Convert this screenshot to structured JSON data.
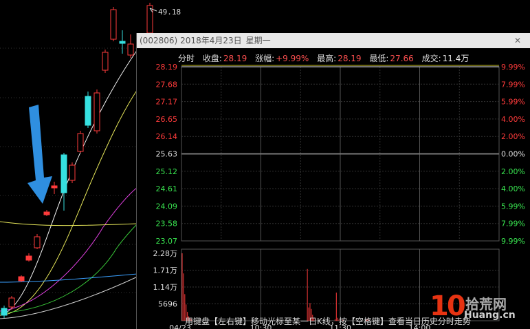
{
  "kline": {
    "high_label": "49.18"
  },
  "popup": {
    "code": "(002806)",
    "date": "2018年4月23日",
    "weekday": "星期一",
    "close_icon": "close-icon"
  },
  "info": {
    "label_fenshi": "分时",
    "label_close": "收盘:",
    "close": "28.19",
    "label_change": "涨幅:",
    "change": "+9.99%",
    "label_high": "最高:",
    "high": "28.19",
    "label_low": "最低:",
    "low": "27.66",
    "label_volume": "成交:",
    "volume": "11.4万"
  },
  "chart_data": {
    "type": "line",
    "price_axis": [
      "28.19",
      "27.68",
      "27.17",
      "26.65",
      "26.14",
      "25.63",
      "25.12",
      "24.61",
      "24.09",
      "23.58",
      "23.07"
    ],
    "pct_axis": [
      "9.99%",
      "7.99%",
      "5.99%",
      "4.00%",
      "2.00%",
      "0.00%",
      "2.00%",
      "4.00%",
      "5.99%",
      "7.99%",
      "9.99%"
    ],
    "volume_axis": [
      "2.28万",
      "1.71万",
      "1.14万",
      "5696"
    ],
    "time_axis": [
      "04/23",
      "10:30",
      "11:30",
      "14:00"
    ],
    "prev_close": 25.63,
    "price_line": [
      28.19
    ],
    "volume_bars": [
      {
        "t": 0,
        "v": 2.28
      },
      {
        "t": 1,
        "v": 1.6
      },
      {
        "t": 2,
        "v": 0.9
      },
      {
        "t": 3,
        "v": 0.55
      },
      {
        "t": 4,
        "v": 0.3
      },
      {
        "t": 5,
        "v": 0.15
      },
      {
        "t": 6,
        "v": 0.08
      },
      {
        "t": 7,
        "v": 0.05
      },
      {
        "t": 95,
        "v": 1.75
      },
      {
        "t": 96,
        "v": 0.45
      },
      {
        "t": 97,
        "v": 0.6
      },
      {
        "t": 98,
        "v": 0.4
      },
      {
        "t": 99,
        "v": 0.2
      },
      {
        "t": 100,
        "v": 0.1
      },
      {
        "t": 101,
        "v": 0.05
      },
      {
        "t": 116,
        "v": 0.05
      },
      {
        "t": 117,
        "v": 0.95
      },
      {
        "t": 118,
        "v": 0.1
      },
      {
        "t": 119,
        "v": 0.04
      },
      {
        "t": 122,
        "v": 0.03
      },
      {
        "t": 140,
        "v": 0.04
      },
      {
        "t": 141,
        "v": 0.08
      }
    ]
  },
  "hint": "用键盘【左右键】移动光标至某一日K线，按【空格键】查看当日历史分时走势",
  "watermark": {
    "number": "10",
    "brand": "拾荒网",
    "url": "Huang.cn"
  },
  "colors": {
    "up": "#ff3b3b",
    "down": "#39e650",
    "flat": "#dddddd",
    "arrow": "#2f8fe0",
    "cyan": "#36e0e0"
  }
}
